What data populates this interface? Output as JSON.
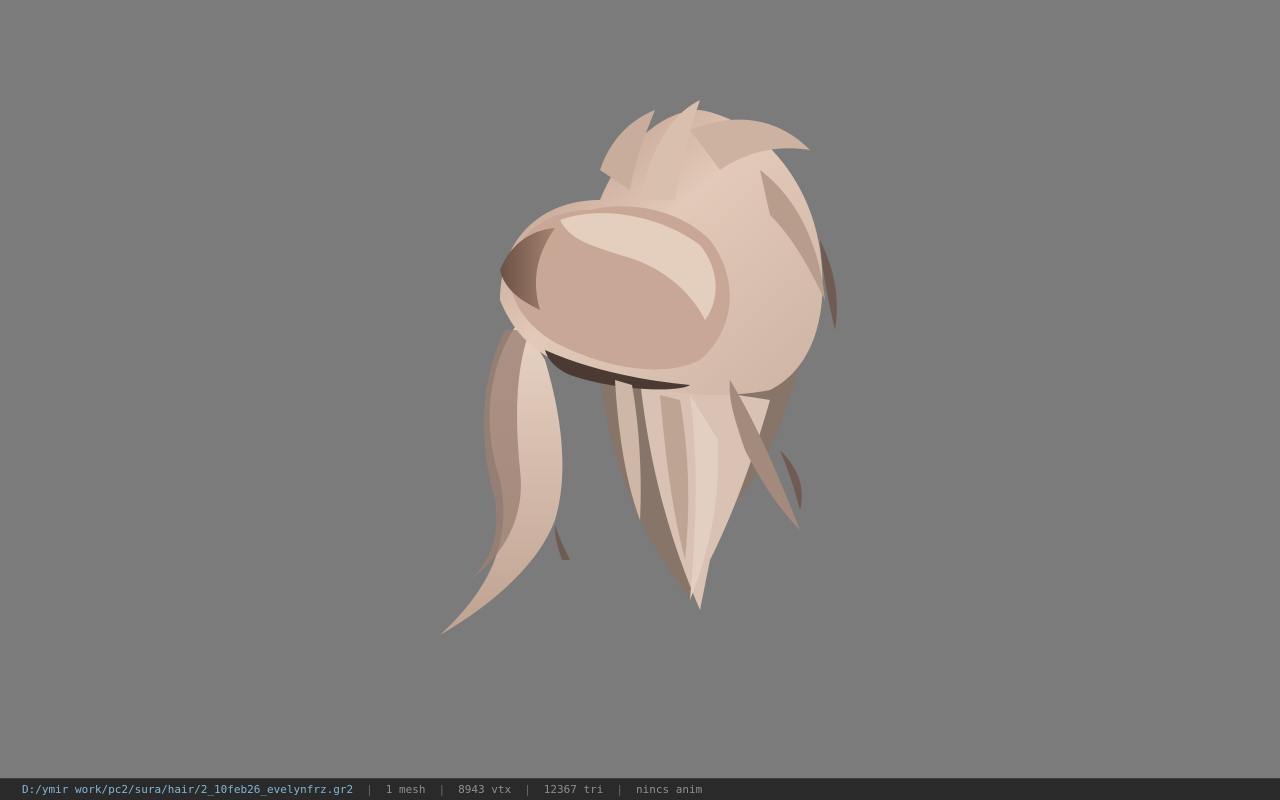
{
  "viewer": {
    "background_color": "#7b7b7b",
    "model": "hair-mesh"
  },
  "statusbar": {
    "file_path": "D:/ymir work/pc2/sura/hair/2_10feb26_evelynfrz.gr2",
    "separator": "|",
    "mesh_count": "1 mesh",
    "vertex_count": "8943 vtx",
    "triangle_count": "12367 tri",
    "anim_status": "nincs anim"
  }
}
